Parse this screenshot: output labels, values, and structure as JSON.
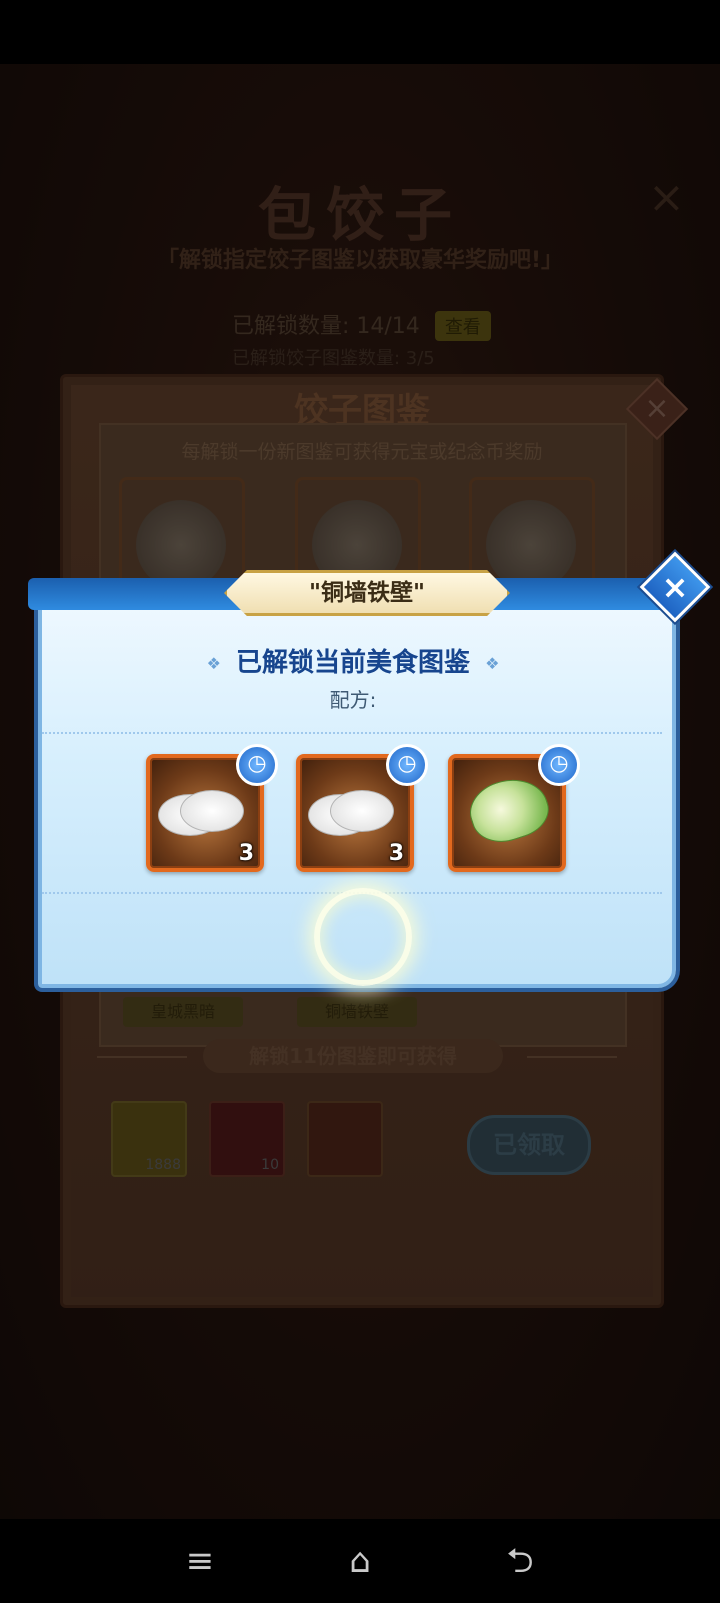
{
  "event": {
    "title": "包饺子",
    "subtitle": "「解锁指定饺子图鉴以获取豪华奖励吧!」",
    "close_icon": "×",
    "unlock_count_label": "已解锁数量: 14/14",
    "unlock_badge": "查看",
    "unlock_count_label2": "已解锁饺子图鉴数量: 3/5"
  },
  "album": {
    "title": "饺子图鉴",
    "close_icon": "×",
    "description": "每解锁一份新图鉴可获得元宝或纪念币奖励",
    "food_names": [
      "皇城黑暗",
      "铜墙铁壁"
    ],
    "reward_banner": "解锁11份图鉴即可获得",
    "rewards": [
      {
        "icon": "gold-ingot-icon",
        "count": "1888"
      },
      {
        "icon": "sword-item-icon",
        "count": "10"
      },
      {
        "icon": "chest-item-icon",
        "count": ""
      }
    ],
    "claimed_label": "已领取"
  },
  "modal": {
    "title": "\"铜墙铁壁\"",
    "close_icon": "×",
    "heading": "已解锁当前美食图鉴",
    "heading_decor": "❖",
    "recipe_label": "配方:",
    "recipe_items": [
      {
        "name": "dumpling-wrapper",
        "quantity": "3",
        "clock": "◷"
      },
      {
        "name": "dumpling-wrapper",
        "quantity": "3",
        "clock": "◷"
      },
      {
        "name": "cabbage",
        "quantity": "",
        "clock": "◷"
      }
    ]
  },
  "nav": {
    "menu_icon": "≡",
    "home_icon": "⌂",
    "back_icon": "⮌"
  }
}
